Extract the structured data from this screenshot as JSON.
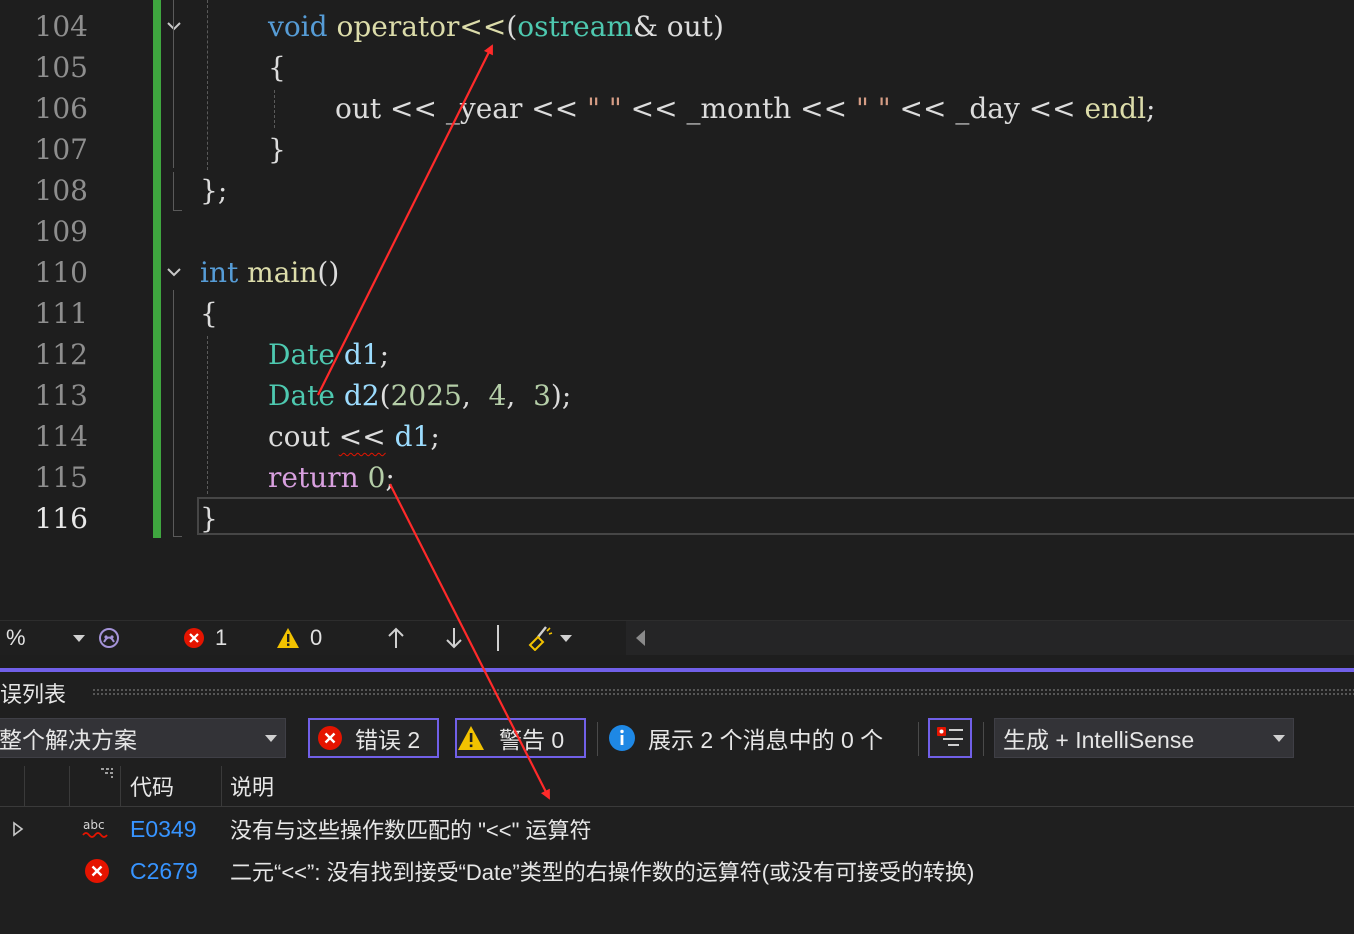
{
  "editor": {
    "line_numbers": [
      "104",
      "105",
      "106",
      "107",
      "108",
      "109",
      "110",
      "111",
      "112",
      "113",
      "114",
      "115",
      "116"
    ],
    "code": {
      "l104": {
        "kw": "void",
        "fn": "operator<<",
        "open": "(",
        "ty": "ostream",
        "amp": "&",
        "param": " out",
        "close": ")"
      },
      "l105": "{",
      "l106": {
        "v1": "out",
        "op1": " << ",
        "v2": "_year",
        "op2": " << ",
        "s1": "\" \"",
        "op3": " << ",
        "v3": "_month",
        "op4": " << ",
        "s2": "\" \"",
        "op5": " << ",
        "v4": "_day",
        "op6": " << ",
        "v5": "endl",
        "semi": ";"
      },
      "l107": "}",
      "l108": "};",
      "l110": {
        "kw": "int",
        "fn": "main",
        "paren": "()"
      },
      "l111": "{",
      "l112": {
        "ty": "Date",
        "var": "d1",
        "semi": ";"
      },
      "l113": {
        "ty": "Date",
        "var": "d2",
        "open": "(",
        "n1": "2025",
        "c1": ",  ",
        "n2": "4",
        "c2": ",  ",
        "n3": "3",
        "close": ");"
      },
      "l114": {
        "id": "cout",
        "op": "<<",
        "var": "d1",
        "semi": ";"
      },
      "l115": {
        "kw": "return",
        "num": "0",
        "semi": ";"
      },
      "l116": "}"
    }
  },
  "status": {
    "zoom": "%",
    "errors": "1",
    "warnings": "0"
  },
  "error_list": {
    "title": "误列表",
    "scope": "整个解决方案",
    "errors_filter": "错误 2",
    "warnings_filter": "警告 0",
    "messages_filter": "展示 2 个消息中的 0 个",
    "build_source": "生成 + IntelliSense",
    "columns": {
      "code": "代码",
      "description": "说明"
    },
    "rows": [
      {
        "code": "E0349",
        "description": "没有与这些操作数匹配的 \"<<\" 运算符",
        "icon": "abc-squiggle-icon"
      },
      {
        "code": "C2679",
        "description": "二元“<<”: 没有找到接受“Date”类型的右操作数的运算符(或没有可接受的转换)",
        "icon": "error-icon"
      }
    ]
  },
  "colors": {
    "keyword": "#569cd6",
    "type": "#4ec9b0",
    "function": "#dcdcaa",
    "variable": "#9cdcfe",
    "number": "#b5cea8",
    "string": "#d69d85",
    "control": "#d8a0df",
    "accent": "#7160e8",
    "error": "#e51400",
    "link": "#3794ff",
    "annotation_arrow": "#ff2a2a"
  }
}
